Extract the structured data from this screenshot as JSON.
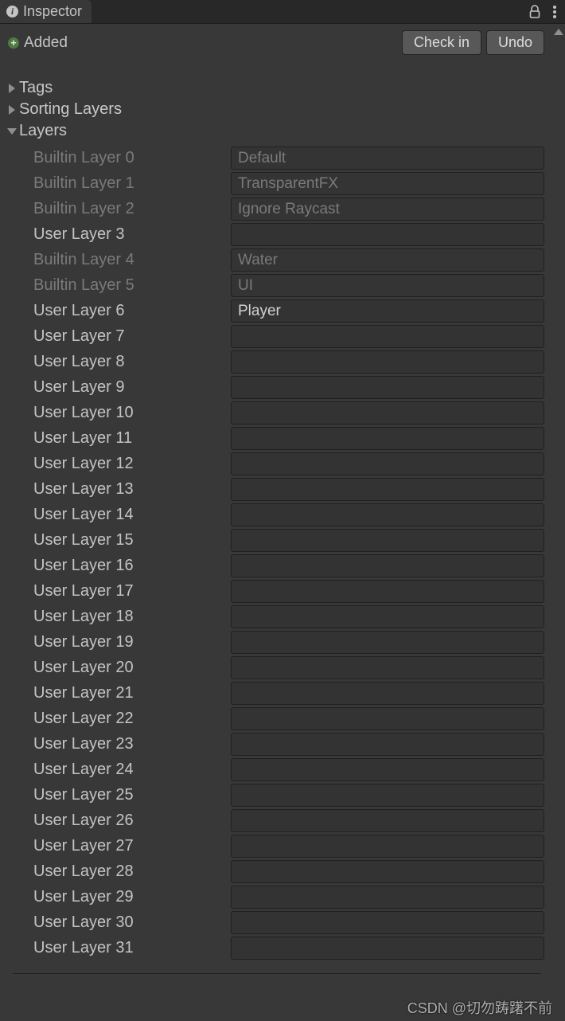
{
  "tab": {
    "title": "Inspector"
  },
  "status": {
    "added_label": "Added"
  },
  "buttons": {
    "check_in": "Check in",
    "undo": "Undo"
  },
  "sections": {
    "tags": "Tags",
    "sorting_layers": "Sorting Layers",
    "layers": "Layers"
  },
  "layers": [
    {
      "label": "Builtin Layer 0",
      "value": "Default",
      "builtin": true,
      "user_editable": false
    },
    {
      "label": "Builtin Layer 1",
      "value": "TransparentFX",
      "builtin": true,
      "user_editable": false
    },
    {
      "label": "Builtin Layer 2",
      "value": "Ignore Raycast",
      "builtin": true,
      "user_editable": false
    },
    {
      "label": "User Layer 3",
      "value": "",
      "builtin": false,
      "user_editable": true
    },
    {
      "label": "Builtin Layer 4",
      "value": "Water",
      "builtin": true,
      "user_editable": false
    },
    {
      "label": "Builtin Layer 5",
      "value": "UI",
      "builtin": true,
      "user_editable": false
    },
    {
      "label": "User Layer 6",
      "value": "Player",
      "builtin": false,
      "user_editable": true
    },
    {
      "label": "User Layer 7",
      "value": "",
      "builtin": false,
      "user_editable": true
    },
    {
      "label": "User Layer 8",
      "value": "",
      "builtin": false,
      "user_editable": true
    },
    {
      "label": "User Layer 9",
      "value": "",
      "builtin": false,
      "user_editable": true
    },
    {
      "label": "User Layer 10",
      "value": "",
      "builtin": false,
      "user_editable": true
    },
    {
      "label": "User Layer 11",
      "value": "",
      "builtin": false,
      "user_editable": true
    },
    {
      "label": "User Layer 12",
      "value": "",
      "builtin": false,
      "user_editable": true
    },
    {
      "label": "User Layer 13",
      "value": "",
      "builtin": false,
      "user_editable": true
    },
    {
      "label": "User Layer 14",
      "value": "",
      "builtin": false,
      "user_editable": true
    },
    {
      "label": "User Layer 15",
      "value": "",
      "builtin": false,
      "user_editable": true
    },
    {
      "label": "User Layer 16",
      "value": "",
      "builtin": false,
      "user_editable": true
    },
    {
      "label": "User Layer 17",
      "value": "",
      "builtin": false,
      "user_editable": true
    },
    {
      "label": "User Layer 18",
      "value": "",
      "builtin": false,
      "user_editable": true
    },
    {
      "label": "User Layer 19",
      "value": "",
      "builtin": false,
      "user_editable": true
    },
    {
      "label": "User Layer 20",
      "value": "",
      "builtin": false,
      "user_editable": true
    },
    {
      "label": "User Layer 21",
      "value": "",
      "builtin": false,
      "user_editable": true
    },
    {
      "label": "User Layer 22",
      "value": "",
      "builtin": false,
      "user_editable": true
    },
    {
      "label": "User Layer 23",
      "value": "",
      "builtin": false,
      "user_editable": true
    },
    {
      "label": "User Layer 24",
      "value": "",
      "builtin": false,
      "user_editable": true
    },
    {
      "label": "User Layer 25",
      "value": "",
      "builtin": false,
      "user_editable": true
    },
    {
      "label": "User Layer 26",
      "value": "",
      "builtin": false,
      "user_editable": true
    },
    {
      "label": "User Layer 27",
      "value": "",
      "builtin": false,
      "user_editable": true
    },
    {
      "label": "User Layer 28",
      "value": "",
      "builtin": false,
      "user_editable": true
    },
    {
      "label": "User Layer 29",
      "value": "",
      "builtin": false,
      "user_editable": true
    },
    {
      "label": "User Layer 30",
      "value": "",
      "builtin": false,
      "user_editable": true
    },
    {
      "label": "User Layer 31",
      "value": "",
      "builtin": false,
      "user_editable": true
    }
  ],
  "watermark": "CSDN @切勿踌躇不前"
}
